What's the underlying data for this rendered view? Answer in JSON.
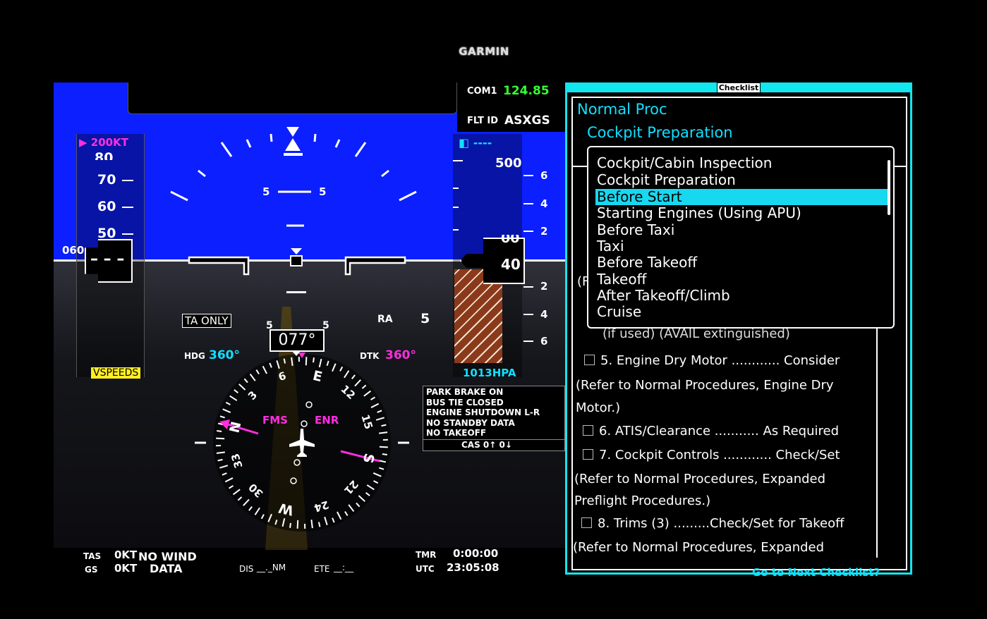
{
  "brand": "GARMIN",
  "com": {
    "label": "COM1",
    "freq": "124.85"
  },
  "fltid": {
    "label": "FLT ID",
    "value": "ASXGS"
  },
  "speed": {
    "bug": "200KT",
    "ticks": [
      "80",
      "70",
      "60",
      "50"
    ],
    "current_partial": "060",
    "vspeeds": "VSPEEDS"
  },
  "altitude": {
    "selected": "----",
    "ticks": [
      "500"
    ],
    "current": "40",
    "current_hi": "00",
    "baro": "1013HPA"
  },
  "vsi": {
    "ticks_up": [
      "6",
      "4",
      "2"
    ],
    "ticks_down": [
      "2",
      "4",
      "6"
    ]
  },
  "attitude": {
    "pitch_left": "5",
    "pitch_right": "5"
  },
  "traffic": {
    "mode": "TA ONLY",
    "ra_label": "RA",
    "ra_value": "5"
  },
  "hsi": {
    "heading": "077°",
    "hdg_label": "HDG",
    "hdg_value": "360°",
    "dtk_label": "DTK",
    "dtk_value": "360°",
    "nav_source": "FMS",
    "nav_mode": "ENR",
    "scale_left": "5",
    "scale_right": "5",
    "card": [
      "E",
      "12",
      "15",
      "S",
      "21",
      "24",
      "W",
      "30",
      "33",
      "N",
      "3",
      "6"
    ]
  },
  "cas": {
    "messages": [
      "PARK BRAKE ON",
      "BUS TIE CLOSED",
      "ENGINE SHUTDOWN L-R",
      "NO STANDBY DATA",
      "NO TAKEOFF"
    ],
    "footer": "CAS  0↑  0↓"
  },
  "bottom": {
    "tas_label": "TAS",
    "tas_value": "0KT",
    "gs_label": "GS",
    "gs_value": "0KT",
    "wind_line1": "NO WIND",
    "wind_line2": "DATA",
    "dis_label": "DIS",
    "dis_value": "__._NM",
    "ete_label": "ETE",
    "ete_value": "__:__",
    "tmr_label": "TMR",
    "tmr_value": "0:00:00",
    "utc_label": "UTC",
    "utc_value": "23:05:08"
  },
  "checklist": {
    "title": "Checklist",
    "group": "Normal Proc",
    "name": "Cockpit Preparation",
    "dropdown": [
      "Cockpit/Cabin Inspection",
      "Cockpit Preparation",
      "Before Start",
      "Starting Engines (Using APU)",
      "Before Taxi",
      "Taxi",
      "Before Takeoff",
      "Takeoff",
      "After Takeoff/Climb",
      "Cruise"
    ],
    "selected_index": 2,
    "partial_left": "(F",
    "partial_line": "(if used)                         (AVAIL extinguished)",
    "items": [
      {
        "label": "5. Engine Dry Motor ............ Consider"
      },
      {
        "note": "(Refer to Normal Procedures, Engine Dry"
      },
      {
        "note": "Motor.)"
      },
      {
        "label": "6. ATIS/Clearance ........... As Required"
      },
      {
        "label": "7. Cockpit Controls ............ Check/Set"
      },
      {
        "note": "(Refer to Normal Procedures, Expanded"
      },
      {
        "note": "Preflight Procedures.)"
      },
      {
        "label": "8. Trims (3) .........Check/Set for Takeoff"
      },
      {
        "note": "(Refer to Normal Procedures, Expanded"
      }
    ],
    "next": "Go to Next Checklist?"
  }
}
